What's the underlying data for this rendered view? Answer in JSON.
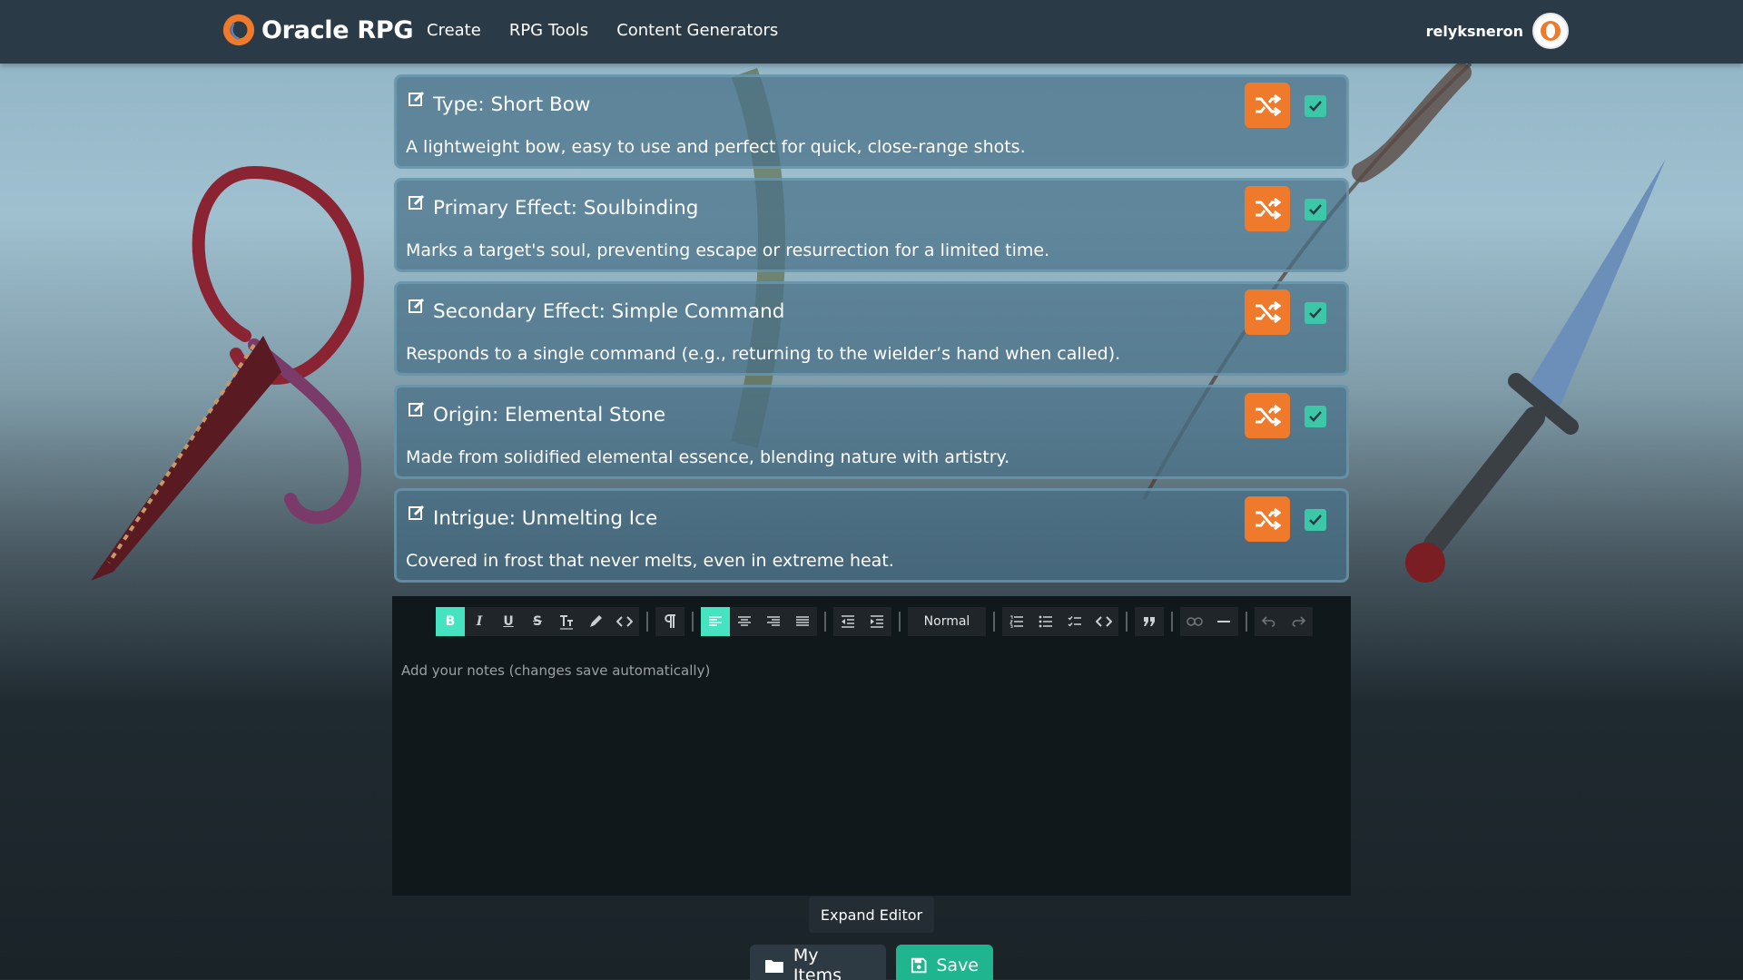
{
  "navbar": {
    "brand": "Oracle RPG",
    "links": [
      "Create",
      "RPG Tools",
      "Content Generators"
    ],
    "username": "relyksneron"
  },
  "cards": [
    {
      "title": "Type: Short Bow",
      "description": "A lightweight bow, easy to use and perfect for quick, close-range shots.",
      "checked": true
    },
    {
      "title": "Primary Effect: Soulbinding",
      "description": "Marks a target's soul, preventing escape or resurrection for a limited time.",
      "checked": true
    },
    {
      "title": "Secondary Effect: Simple Command",
      "description": "Responds to a single command (e.g., returning to the wielder’s hand when called).",
      "checked": true
    },
    {
      "title": "Origin: Elemental Stone",
      "description": "Made from solidified elemental essence, blending nature with artistry.",
      "checked": true
    },
    {
      "title": "Intrigue: Unmelting Ice",
      "description": "Covered in frost that never melts, even in extreme heat.",
      "checked": true
    }
  ],
  "editor": {
    "heading_select": "Normal",
    "placeholder": "Add your notes (changes save automatically)"
  },
  "buttons": {
    "expand": "Expand Editor",
    "my_items": "My Items",
    "save": "Save"
  },
  "colors": {
    "navbar": "#2b3a47",
    "shuffle": "#f07a2c",
    "checkbox": "#3cc8a8",
    "toolbar_active": "#46e3c0",
    "save": "#1eb58f"
  }
}
